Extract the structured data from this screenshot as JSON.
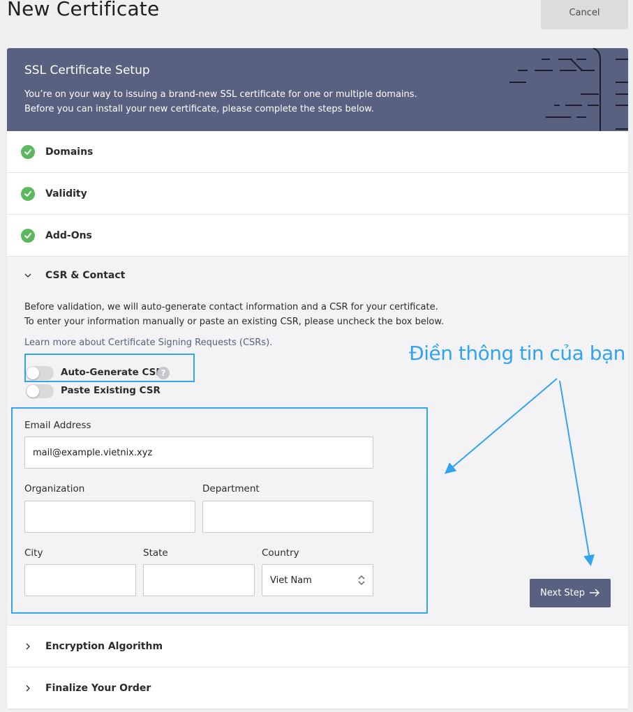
{
  "header": {
    "title": "New Certificate",
    "cancel_label": "Cancel"
  },
  "banner": {
    "title": "SSL Certificate Setup",
    "line1": "You’re on your way to issuing a brand-new SSL certificate for one or multiple domains.",
    "line2": "Before you can install your new certificate, please complete the steps below."
  },
  "steps": {
    "domains": "Domains",
    "validity": "Validity",
    "addons": "Add-Ons",
    "csr_contact": "CSR & Contact",
    "encryption": "Encryption Algorithm",
    "finalize": "Finalize Your Order"
  },
  "csr": {
    "desc1": "Before validation, we will auto-generate contact information and a CSR for your certificate.",
    "desc2": "To enter your information manually or paste an existing CSR, please uncheck the box below.",
    "learn_more": "Learn more about Certificate Signing Requests (CSRs).",
    "auto_generate_label": "Auto-Generate CSR",
    "auto_generate_on": false,
    "paste_existing_label": "Paste Existing CSR",
    "paste_existing_on": false,
    "help_glyph": "?"
  },
  "form": {
    "email_label": "Email Address",
    "email_value": "mail@example.vietnix.xyz",
    "organization_label": "Organization",
    "organization_value": "",
    "department_label": "Department",
    "department_value": "",
    "city_label": "City",
    "city_value": "",
    "state_label": "State",
    "state_value": "",
    "country_label": "Country",
    "country_value": "Viet Nam",
    "next_label": "Next Step"
  },
  "annotation": {
    "text": "Điền thông tin của bạn",
    "color": "#32a3f0"
  },
  "colors": {
    "banner": "#586180",
    "check": "#5cb85c",
    "highlight": "#32a3f0"
  },
  "icons": {
    "check": "check-circle-icon",
    "expanded": "chevron-down-icon",
    "collapsed": "chevron-right-icon",
    "next": "arrow-right-icon",
    "select": "updown-arrows-icon",
    "help": "question-icon"
  }
}
